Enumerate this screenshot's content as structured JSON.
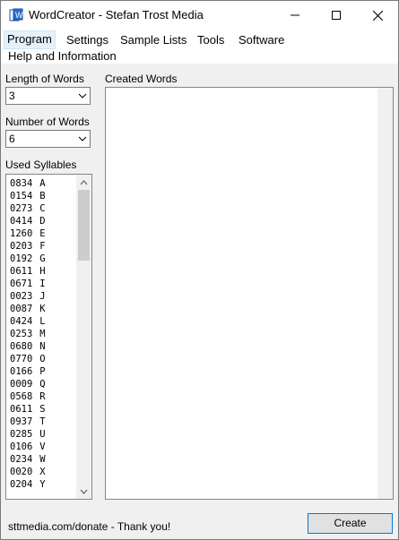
{
  "window": {
    "title": "WordCreator - Stefan Trost Media",
    "controls": [
      "minimize",
      "maximize",
      "close"
    ]
  },
  "menu": {
    "items": [
      "Program",
      "Settings",
      "Sample Lists",
      "Tools",
      "Software",
      "Help and Information"
    ],
    "active": "Program"
  },
  "settings": {
    "length_label": "Length of Words",
    "length_value": "3",
    "number_label": "Number of Words",
    "number_value": "6",
    "syllables_label": "Used Syllables"
  },
  "syllables": [
    {
      "count": "0834",
      "letter": "A"
    },
    {
      "count": "0154",
      "letter": "B"
    },
    {
      "count": "0273",
      "letter": "C"
    },
    {
      "count": "0414",
      "letter": "D"
    },
    {
      "count": "1260",
      "letter": "E"
    },
    {
      "count": "0203",
      "letter": "F"
    },
    {
      "count": "0192",
      "letter": "G"
    },
    {
      "count": "0611",
      "letter": "H"
    },
    {
      "count": "0671",
      "letter": "I"
    },
    {
      "count": "0023",
      "letter": "J"
    },
    {
      "count": "0087",
      "letter": "K"
    },
    {
      "count": "0424",
      "letter": "L"
    },
    {
      "count": "0253",
      "letter": "M"
    },
    {
      "count": "0680",
      "letter": "N"
    },
    {
      "count": "0770",
      "letter": "O"
    },
    {
      "count": "0166",
      "letter": "P"
    },
    {
      "count": "0009",
      "letter": "Q"
    },
    {
      "count": "0568",
      "letter": "R"
    },
    {
      "count": "0611",
      "letter": "S"
    },
    {
      "count": "0937",
      "letter": "T"
    },
    {
      "count": "0285",
      "letter": "U"
    },
    {
      "count": "0106",
      "letter": "V"
    },
    {
      "count": "0234",
      "letter": "W"
    },
    {
      "count": "0020",
      "letter": "X"
    },
    {
      "count": "0204",
      "letter": "Y"
    }
  ],
  "output": {
    "label": "Created Words",
    "value": ""
  },
  "footer": {
    "donate_text": "sttmedia.com/donate - Thank you!",
    "create_label": "Create"
  },
  "colors": {
    "focus_border": "#0078d7",
    "window_bg": "#f0f0f0"
  }
}
